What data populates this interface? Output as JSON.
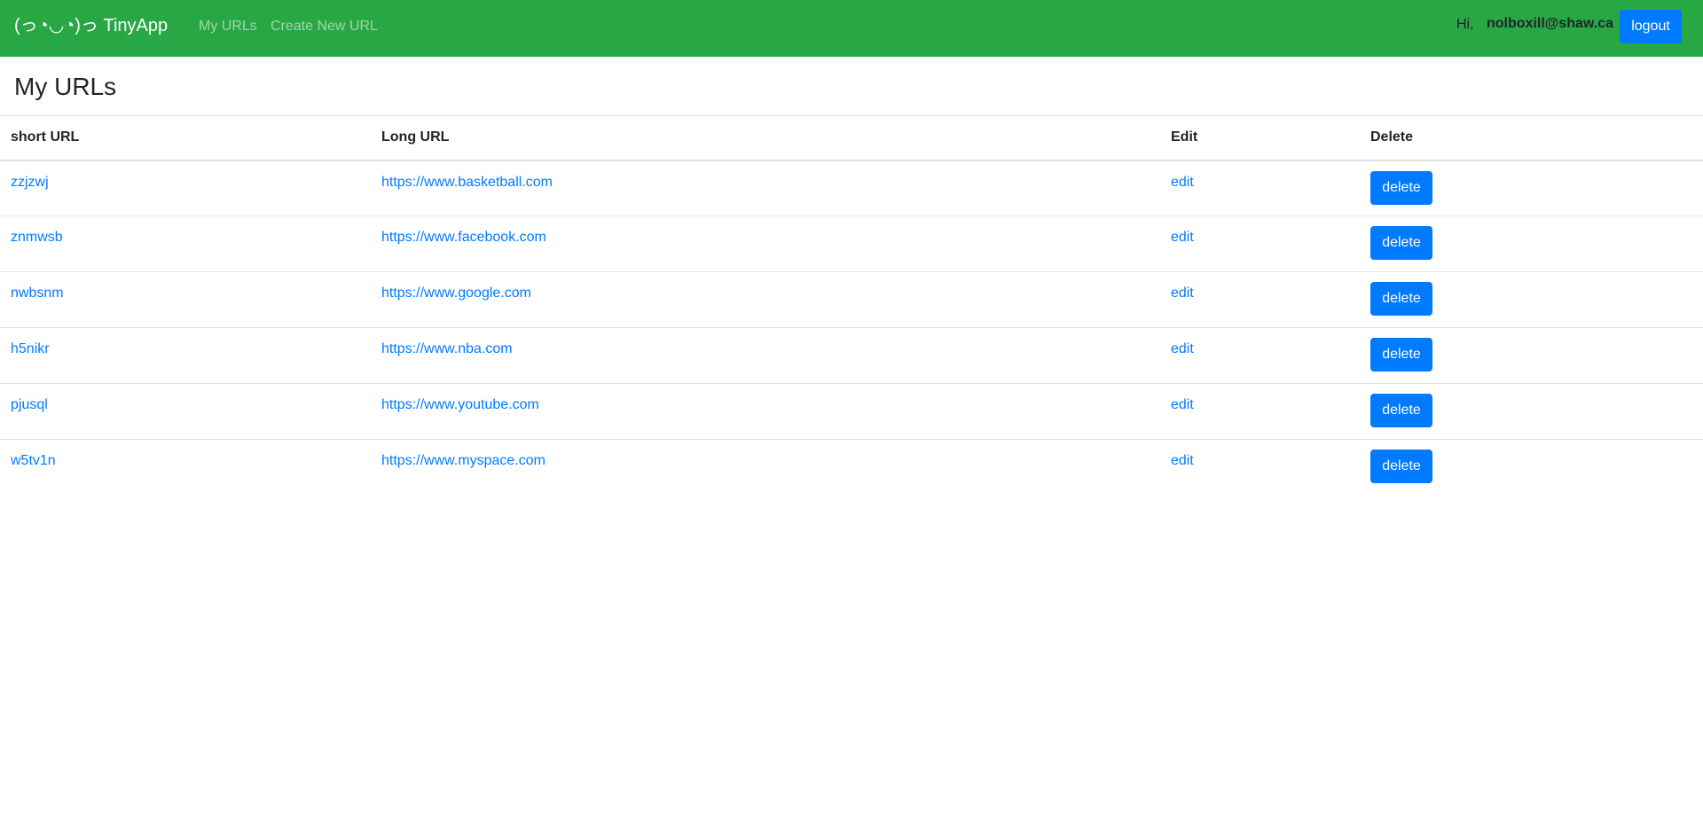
{
  "navbar": {
    "brand": "(っ◔◡◔)っ TinyApp",
    "links": [
      "My URLs",
      "Create New URL"
    ],
    "greeting": "Hi,",
    "user_email": "nolboxill@shaw.ca",
    "logout_label": "logout",
    "background_color": "#28a745"
  },
  "page": {
    "title": "My URLs"
  },
  "table": {
    "headers": [
      "short URL",
      "Long URL",
      "Edit",
      "Delete"
    ],
    "rows": [
      {
        "short": "zzjzwj",
        "long": "https://www.basketball.com",
        "edit": "edit",
        "delete": "delete"
      },
      {
        "short": "znmwsb",
        "long": "https://www.facebook.com",
        "edit": "edit",
        "delete": "delete"
      },
      {
        "short": "nwbsnm",
        "long": "https://www.google.com",
        "edit": "edit",
        "delete": "delete"
      },
      {
        "short": "h5nikr",
        "long": "https://www.nba.com",
        "edit": "edit",
        "delete": "delete"
      },
      {
        "short": "pjusql",
        "long": "https://www.youtube.com",
        "edit": "edit",
        "delete": "delete"
      },
      {
        "short": "w5tv1n",
        "long": "https://www.myspace.com",
        "edit": "edit",
        "delete": "delete"
      }
    ]
  },
  "colors": {
    "accent": "#007bff",
    "text": "#212529",
    "border": "#dee2e6"
  }
}
